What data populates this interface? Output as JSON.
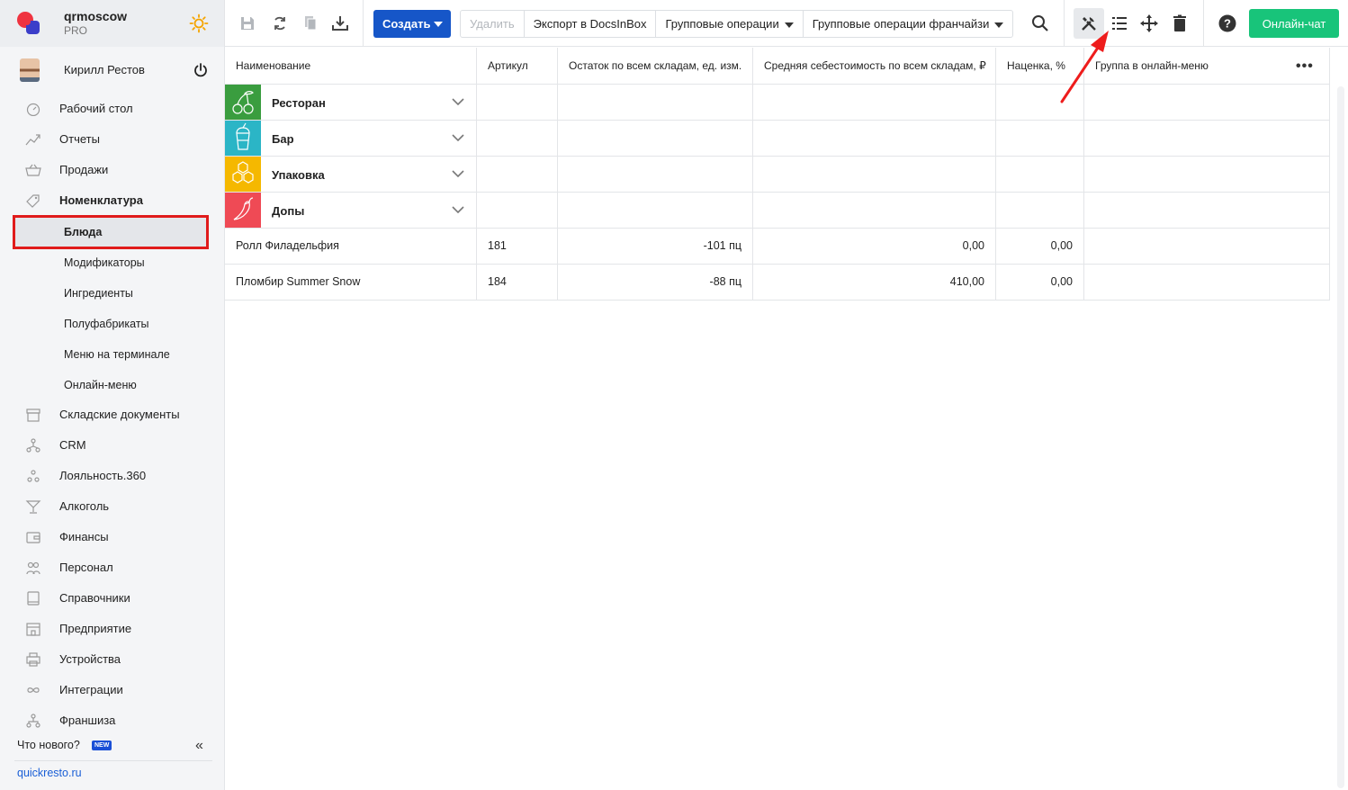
{
  "brand": {
    "org": "qrmoscow",
    "plan": "PRO"
  },
  "user": {
    "name": "Кирилл Рестов"
  },
  "nav": {
    "dashboard": "Рабочий стол",
    "reports": "Отчеты",
    "sales": "Продажи",
    "nomenclature": "Номенклатура",
    "sub": {
      "dishes": "Блюда",
      "modifiers": "Модификаторы",
      "ingredients": "Ингредиенты",
      "semi": "Полуфабрикаты",
      "terminal_menu": "Меню на терминале",
      "online_menu": "Онлайн-меню"
    },
    "warehouse": "Складские документы",
    "crm": "CRM",
    "loyalty": "Лояльность.360",
    "alcohol": "Алкоголь",
    "finance": "Финансы",
    "staff": "Персонал",
    "refs": "Справочники",
    "enterprise": "Предприятие",
    "devices": "Устройства",
    "integrations": "Интеграции",
    "franchise": "Франшиза"
  },
  "footer": {
    "whatsnew": "Что нового?",
    "badge": "NEW",
    "site": "quickresto.ru"
  },
  "toolbar": {
    "create": "Создать",
    "delete": "Удалить",
    "export": "Экспорт в DocsInBox",
    "group_ops": "Групповые операции",
    "group_ops_franchise": "Групповые операции франчайзи",
    "chat": "Онлайн-чат"
  },
  "columns": {
    "name": "Наименование",
    "article": "Артикул",
    "stock": "Остаток по всем складам, ед. изм.",
    "cost": "Средняя себестоимость по всем складам, ₽",
    "markup": "Наценка, %",
    "online_group": "Группа в онлайн-меню"
  },
  "categories": [
    {
      "name": "Ресторан",
      "color": "#3a9d3f",
      "icon": "cherries-icon"
    },
    {
      "name": "Бар",
      "color": "#2bb5c6",
      "icon": "cocktail-glass-icon"
    },
    {
      "name": "Упаковка",
      "color": "#f5b800",
      "icon": "honeycomb-icon"
    },
    {
      "name": "Допы",
      "color": "#ef4a55",
      "icon": "chili-pepper-icon"
    }
  ],
  "rows": [
    {
      "name": "Ролл Филадельфия",
      "article": "181",
      "stock": "-101 пц",
      "cost": "0,00",
      "markup": "0,00"
    },
    {
      "name": "Пломбир Summer Snow",
      "article": "184",
      "stock": "-88 пц",
      "cost": "410,00",
      "markup": "0,00"
    }
  ]
}
